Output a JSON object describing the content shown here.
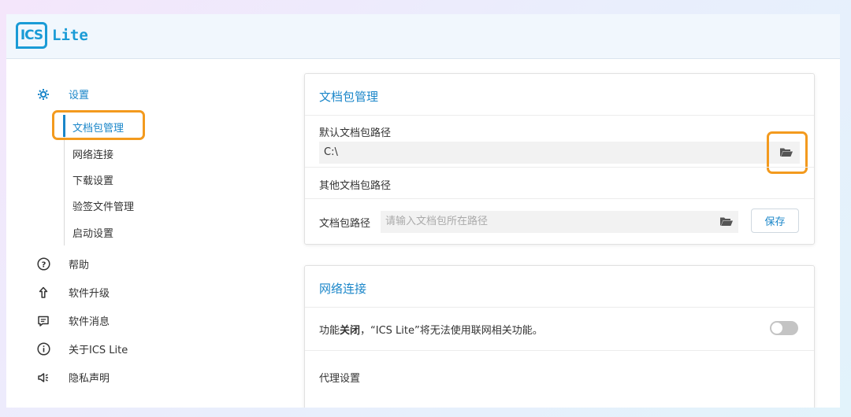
{
  "app": {
    "logo_mark": "ICS",
    "logo_text": "Lite"
  },
  "sidebar": {
    "settings": {
      "label": "设置",
      "icon": "gear-icon"
    },
    "sub_items": [
      {
        "label": "文档包管理",
        "active": true
      },
      {
        "label": "网络连接"
      },
      {
        "label": "下载设置"
      },
      {
        "label": "验签文件管理"
      },
      {
        "label": "启动设置"
      }
    ],
    "items": [
      {
        "label": "帮助",
        "icon": "help-icon"
      },
      {
        "label": "软件升级",
        "icon": "upgrade-icon"
      },
      {
        "label": "软件消息",
        "icon": "message-icon"
      },
      {
        "label": "关于ICS Lite",
        "icon": "info-icon"
      },
      {
        "label": "隐私声明",
        "icon": "megaphone-icon"
      }
    ]
  },
  "doc_card": {
    "title": "文档包管理",
    "default_path_label": "默认文档包路径",
    "default_path_value": "C:\\",
    "other_path_label": "其他文档包路径",
    "path_field_label": "文档包路径",
    "path_placeholder": "请输入文档包所在路径",
    "save_label": "保存"
  },
  "network_card": {
    "title": "网络连接",
    "status_prefix": "功能",
    "status_bold": "关闭",
    "status_suffix": "，“ICS Lite”将无法使用联网相关功能。",
    "toggle_on": false,
    "proxy_label": "代理设置"
  },
  "colors": {
    "accent": "#1a86c9",
    "highlight": "#f39a1e"
  }
}
